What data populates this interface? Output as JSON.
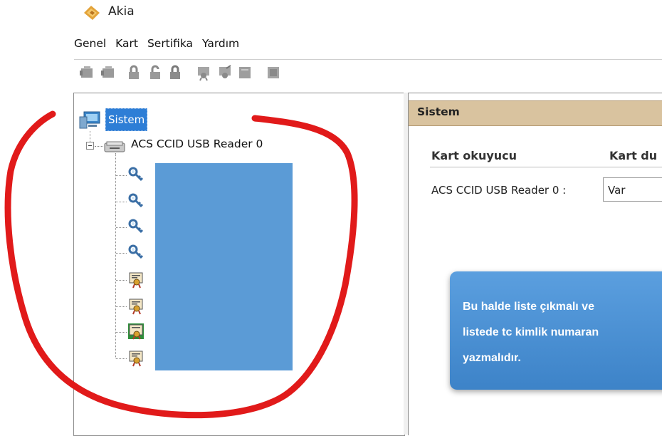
{
  "window": {
    "title": "Akia"
  },
  "menu": [
    "Genel",
    "Kart",
    "Sertifika",
    "Yardım"
  ],
  "toolbar": {
    "buttons": [
      {
        "name": "card-reader-icon"
      },
      {
        "name": "card-reader-2-icon"
      },
      {
        "name": "lock-icon"
      },
      {
        "name": "unlock-icon"
      },
      {
        "name": "lock-change-icon"
      },
      {
        "name": "certificate-import-icon"
      },
      {
        "name": "certificate-edit-icon"
      },
      {
        "name": "certificate-icon"
      },
      {
        "name": "certificate-view-icon"
      }
    ]
  },
  "tree": {
    "root_label": "Sistem",
    "reader_label": "ACS CCID USB Reader 0",
    "children": [
      {
        "icon": "key-icon"
      },
      {
        "icon": "key-icon"
      },
      {
        "icon": "key-icon"
      },
      {
        "icon": "key-icon"
      },
      {
        "icon": "certificate-icon"
      },
      {
        "icon": "certificate-icon"
      },
      {
        "icon": "certificate-selected-icon"
      },
      {
        "icon": "certificate-icon"
      }
    ]
  },
  "right_panel": {
    "header": "Sistem",
    "col_reader": "Kart okuyucu",
    "col_status": "Kart du",
    "reader_row_label": "ACS CCID USB Reader 0 :",
    "reader_row_status": "Var"
  },
  "callout": {
    "lines": [
      "Bu halde liste çıkmalı ve",
      "listede tc kimlik numaran",
      "yazmalıdır."
    ]
  },
  "colors": {
    "selection": "#2e7ed6",
    "panel_header": "#d9c39f",
    "mask": "#5b9bd6",
    "annotation": "#e11a1a",
    "callout": "#4a90d5"
  }
}
